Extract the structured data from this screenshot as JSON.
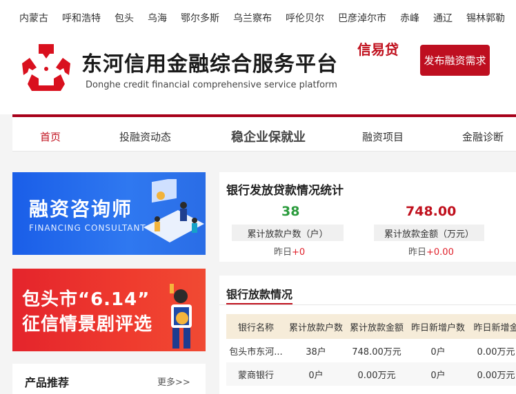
{
  "cities": [
    "内蒙古",
    "呼和浩特",
    "包头",
    "乌海",
    "鄂尔多斯",
    "乌兰察布",
    "呼伦贝尔",
    "巴彦淖尔市",
    "赤峰",
    "通辽",
    "锡林郭勒"
  ],
  "header": {
    "title": "东河信用金融综合服务平台",
    "subtitle": "Donghe credit financial comprehensive service platform",
    "tag": "信易贷",
    "publish_btn": "发布融资需求"
  },
  "nav": [
    "首页",
    "投融资动态",
    "稳企业保就业",
    "融资项目",
    "金融诊断"
  ],
  "banners": {
    "b1_title": "融资咨询师",
    "b1_sub": "FINANCING CONSULTANT",
    "b2_line1": "包头市“6.14”",
    "b2_line2": "征信情景剧评选"
  },
  "product": {
    "title": "产品推荐",
    "more": "更多>>"
  },
  "stats": {
    "title": "银行发放贷款情况统计",
    "households": "38",
    "households_label": "累计放款户数（户）",
    "households_prefix": "昨日",
    "households_delta": "+0",
    "amount": "748.00",
    "amount_label": "累计放款金额（万元）",
    "amount_prefix": "昨日",
    "amount_delta": "+0.00"
  },
  "loan_table": {
    "title": "银行放款情况",
    "headers": [
      "银行名称",
      "累计放款户数",
      "累计放款金额",
      "昨日新增户数",
      "昨日新增金"
    ],
    "rows": [
      [
        "包头市东河...",
        "38户",
        "748.00万元",
        "0户",
        "0.00万元"
      ],
      [
        "蒙商银行",
        "0户",
        "0.00万元",
        "0户",
        "0.00万元"
      ]
    ]
  },
  "colors": {
    "brand_red": "#c0101d",
    "green": "#2a9b3c",
    "header_row": "#f6ecd9"
  }
}
